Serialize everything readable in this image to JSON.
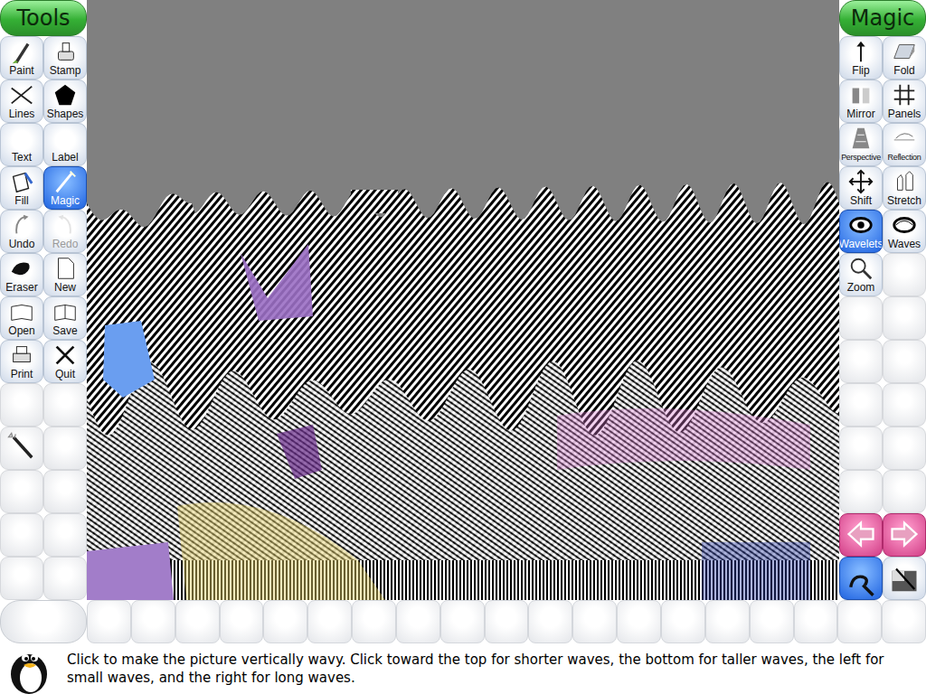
{
  "toolbar": {
    "title": "Tools",
    "items": [
      {
        "label": "Paint",
        "selected": false,
        "disabled": false
      },
      {
        "label": "Stamp",
        "selected": false,
        "disabled": false
      },
      {
        "label": "Lines",
        "selected": false,
        "disabled": false
      },
      {
        "label": "Shapes",
        "selected": false,
        "disabled": false
      },
      {
        "label": "Text",
        "selected": false,
        "disabled": false
      },
      {
        "label": "Label",
        "selected": false,
        "disabled": false
      },
      {
        "label": "Fill",
        "selected": false,
        "disabled": false
      },
      {
        "label": "Magic",
        "selected": true,
        "disabled": false
      },
      {
        "label": "Undo",
        "selected": false,
        "disabled": false
      },
      {
        "label": "Redo",
        "selected": false,
        "disabled": true
      },
      {
        "label": "Eraser",
        "selected": false,
        "disabled": false
      },
      {
        "label": "New",
        "selected": false,
        "disabled": false
      },
      {
        "label": "Open",
        "selected": false,
        "disabled": false
      },
      {
        "label": "Save",
        "selected": false,
        "disabled": false
      },
      {
        "label": "Print",
        "selected": false,
        "disabled": false
      },
      {
        "label": "Quit",
        "selected": false,
        "disabled": false
      }
    ]
  },
  "magic": {
    "title": "Magic",
    "items": [
      {
        "label": "Flip",
        "selected": false
      },
      {
        "label": "Fold",
        "selected": false
      },
      {
        "label": "Mirror",
        "selected": false
      },
      {
        "label": "Panels",
        "selected": false
      },
      {
        "label": "Perspective",
        "selected": false
      },
      {
        "label": "Reflection",
        "selected": false
      },
      {
        "label": "Shift",
        "selected": false
      },
      {
        "label": "Stretch",
        "selected": false
      },
      {
        "label": "Wavelets",
        "selected": true
      },
      {
        "label": "Waves",
        "selected": false
      },
      {
        "label": "Zoom",
        "selected": false
      }
    ],
    "modes": [
      {
        "selected": true
      },
      {
        "selected": false
      }
    ]
  },
  "instructions": "Click to make the picture vertically wavy. Click toward the top for shorter waves, the bottom for taller waves, the left for small waves, and the right for long waves."
}
